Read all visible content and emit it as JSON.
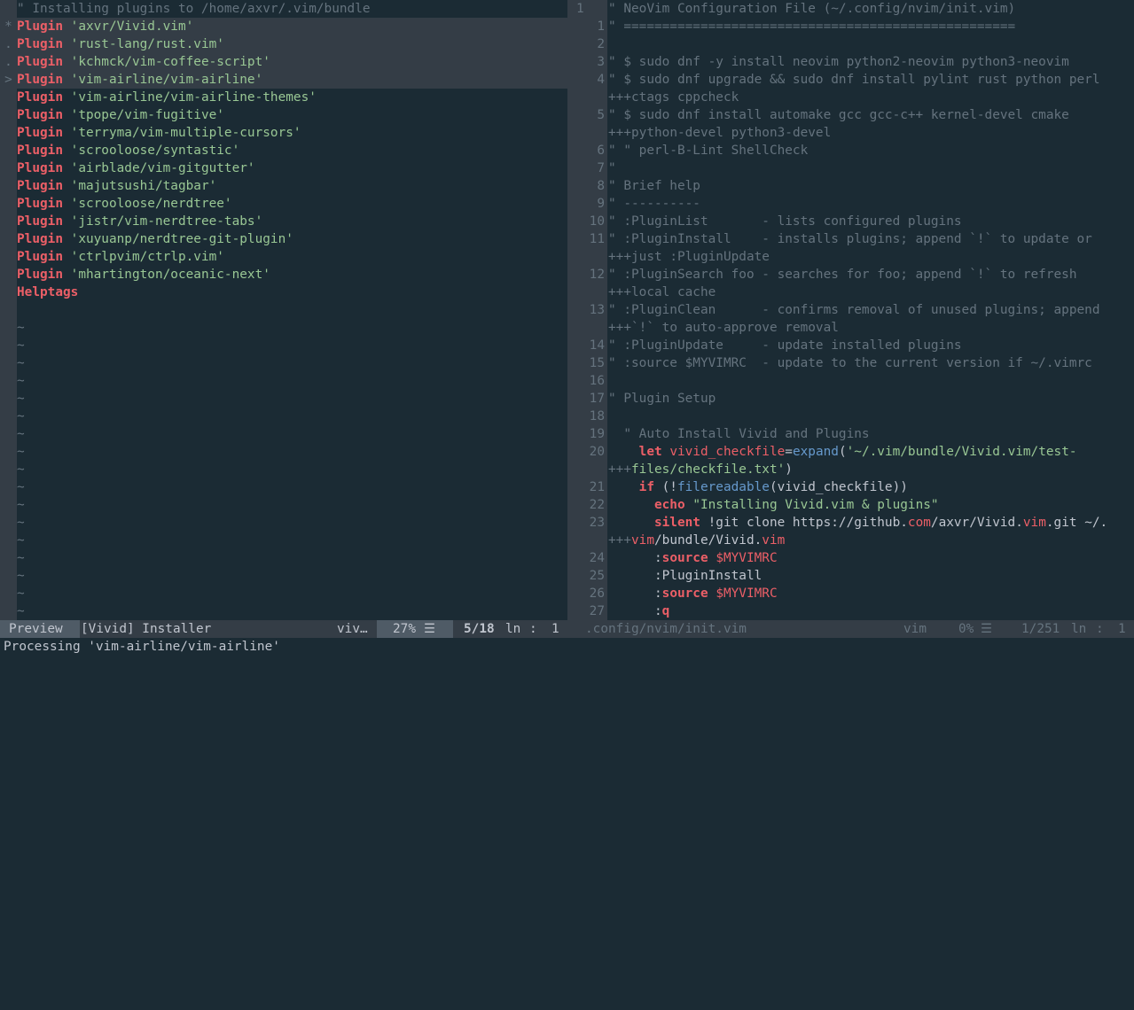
{
  "left": {
    "header": "\" Installing plugins to /home/axvr/.vim/bundle",
    "keyword": "Plugin",
    "plugins": [
      {
        "mark": "*",
        "name": "'axvr/Vivid.vim'",
        "highlight": true
      },
      {
        "mark": ".",
        "name": "'rust-lang/rust.vim'",
        "highlight": true
      },
      {
        "mark": ".",
        "name": "'kchmck/vim-coffee-script'",
        "highlight": true
      },
      {
        "mark": ">",
        "name": "'vim-airline/vim-airline'",
        "highlight": true
      },
      {
        "mark": "",
        "name": "'vim-airline/vim-airline-themes'",
        "highlight": false
      },
      {
        "mark": "",
        "name": "'tpope/vim-fugitive'",
        "highlight": false
      },
      {
        "mark": "",
        "name": "'terryma/vim-multiple-cursors'",
        "highlight": false
      },
      {
        "mark": "",
        "name": "'scrooloose/syntastic'",
        "highlight": false
      },
      {
        "mark": "",
        "name": "'airblade/vim-gitgutter'",
        "highlight": false
      },
      {
        "mark": "",
        "name": "'majutsushi/tagbar'",
        "highlight": false
      },
      {
        "mark": "",
        "name": "'scrooloose/nerdtree'",
        "highlight": false
      },
      {
        "mark": "",
        "name": "'jistr/vim-nerdtree-tabs'",
        "highlight": false
      },
      {
        "mark": "",
        "name": "'xuyuanp/nerdtree-git-plugin'",
        "highlight": false
      },
      {
        "mark": "",
        "name": "'ctrlpvim/ctrlp.vim'",
        "highlight": false
      },
      {
        "mark": "",
        "name": "'mhartington/oceanic-next'",
        "highlight": false
      }
    ],
    "helptags": "Helptags",
    "tilde_count": 17
  },
  "right": {
    "lines": [
      {
        "n": "1",
        "parts": [
          [
            "c",
            "\" NeoVim Configuration File (~/.config/nvim/init.vim)"
          ]
        ],
        "top_num": true
      },
      {
        "n": "1",
        "parts": [
          [
            "c",
            "\" ==================================================="
          ]
        ]
      },
      {
        "n": "2",
        "parts": []
      },
      {
        "n": "3",
        "parts": [
          [
            "c",
            "\" $ sudo dnf -y install neovim python2-neovim python3-neovim"
          ]
        ]
      },
      {
        "n": "4",
        "parts": [
          [
            "c",
            "\" $ sudo dnf upgrade && sudo dnf install pylint rust python perl"
          ]
        ]
      },
      {
        "n": "",
        "parts": [
          [
            "pl",
            "+++"
          ],
          [
            "c",
            "ctags cppcheck"
          ]
        ]
      },
      {
        "n": "5",
        "parts": [
          [
            "c",
            "\" $ sudo dnf install automake gcc gcc-c++ kernel-devel cmake"
          ]
        ]
      },
      {
        "n": "",
        "parts": [
          [
            "pl",
            "+++"
          ],
          [
            "c",
            "python-devel python3-devel"
          ]
        ]
      },
      {
        "n": "6",
        "parts": [
          [
            "c",
            "\" \" perl-B-Lint ShellCheck"
          ]
        ]
      },
      {
        "n": "7",
        "parts": [
          [
            "c",
            "\""
          ]
        ]
      },
      {
        "n": "8",
        "parts": [
          [
            "c",
            "\" Brief help"
          ]
        ]
      },
      {
        "n": "9",
        "parts": [
          [
            "c",
            "\" ----------"
          ]
        ]
      },
      {
        "n": "10",
        "parts": [
          [
            "c",
            "\" :PluginList       - lists configured plugins"
          ]
        ]
      },
      {
        "n": "11",
        "parts": [
          [
            "c",
            "\" :PluginInstall    - installs plugins; append `!` to update or"
          ]
        ]
      },
      {
        "n": "",
        "parts": [
          [
            "pl",
            "+++"
          ],
          [
            "c",
            "just :PluginUpdate"
          ]
        ]
      },
      {
        "n": "12",
        "parts": [
          [
            "c",
            "\" :PluginSearch foo - searches for foo; append `!` to refresh"
          ]
        ]
      },
      {
        "n": "",
        "parts": [
          [
            "pl",
            "+++"
          ],
          [
            "c",
            "local cache"
          ]
        ]
      },
      {
        "n": "13",
        "parts": [
          [
            "c",
            "\" :PluginClean      - confirms removal of unused plugins; append"
          ]
        ]
      },
      {
        "n": "",
        "parts": [
          [
            "pl",
            "+++"
          ],
          [
            "c",
            "`!` to auto-approve removal"
          ]
        ]
      },
      {
        "n": "14",
        "parts": [
          [
            "c",
            "\" :PluginUpdate     - update installed plugins"
          ]
        ]
      },
      {
        "n": "15",
        "parts": [
          [
            "c",
            "\" :source $MYVIMRC  - update to the current version if ~/.vimrc"
          ]
        ]
      },
      {
        "n": "16",
        "parts": []
      },
      {
        "n": "17",
        "parts": [
          [
            "c",
            "\" Plugin Setup"
          ]
        ]
      },
      {
        "n": "18",
        "parts": []
      },
      {
        "n": "19",
        "parts": [
          [
            "c",
            "  \" Auto Install Vivid and Plugins"
          ]
        ]
      },
      {
        "n": "20",
        "parts": [
          [
            "t",
            "    "
          ],
          [
            "kw2",
            "let"
          ],
          [
            "t",
            " "
          ],
          [
            "vr",
            "vivid_checkfile"
          ],
          [
            "t",
            "="
          ],
          [
            "fn",
            "expand"
          ],
          [
            "t",
            "("
          ],
          [
            "dq",
            "'~/.vim/bundle/Vivid.vim/test-"
          ]
        ]
      },
      {
        "n": "",
        "parts": [
          [
            "pl",
            "+++"
          ],
          [
            "dq",
            "files/checkfile.txt'"
          ],
          [
            "t",
            ")"
          ]
        ]
      },
      {
        "n": "21",
        "parts": [
          [
            "t",
            "    "
          ],
          [
            "kw2",
            "if"
          ],
          [
            "t",
            " (!"
          ],
          [
            "fn",
            "filereadable"
          ],
          [
            "t",
            "(vivid_checkfile))"
          ]
        ]
      },
      {
        "n": "22",
        "parts": [
          [
            "t",
            "      "
          ],
          [
            "kw2",
            "echo"
          ],
          [
            "t",
            " "
          ],
          [
            "dq",
            "\"Installing Vivid.vim & plugins\""
          ]
        ]
      },
      {
        "n": "23",
        "parts": [
          [
            "t",
            "      "
          ],
          [
            "kw2",
            "silent"
          ],
          [
            "t",
            " !git clone https://github."
          ],
          [
            "vr",
            "com"
          ],
          [
            "t",
            "/axvr/Vivid."
          ],
          [
            "vr",
            "vim"
          ],
          [
            "t",
            ".git ~/."
          ]
        ]
      },
      {
        "n": "",
        "parts": [
          [
            "pl",
            "+++"
          ],
          [
            "vr",
            "vim"
          ],
          [
            "t",
            "/bundle/Vivid."
          ],
          [
            "vr",
            "vim"
          ]
        ]
      },
      {
        "n": "24",
        "parts": [
          [
            "t",
            "      :"
          ],
          [
            "kw2",
            "source"
          ],
          [
            "t",
            " "
          ],
          [
            "vr",
            "$MYVIMRC"
          ]
        ]
      },
      {
        "n": "25",
        "parts": [
          [
            "t",
            "      :PluginInstall"
          ]
        ]
      },
      {
        "n": "26",
        "parts": [
          [
            "t",
            "      :"
          ],
          [
            "kw2",
            "source"
          ],
          [
            "t",
            " "
          ],
          [
            "vr",
            "$MYVIMRC"
          ]
        ]
      },
      {
        "n": "27",
        "parts": [
          [
            "t",
            "      :"
          ],
          [
            "kw2",
            "q"
          ]
        ]
      }
    ]
  },
  "status": {
    "mode": "Preview",
    "left_name": "[Vivid] Installer",
    "left_ft": "viv…",
    "left_pct": "27%",
    "left_icon": "☰",
    "left_pos": "5/18",
    "left_ln": "ln",
    "left_colon": ":",
    "left_col": "1",
    "right_file": ".config/nvim/init.vim",
    "right_ft": "vim",
    "right_pct": "0%",
    "right_icon": "☰",
    "right_pos": "1/251",
    "right_ln": "ln",
    "right_colon": ":",
    "right_col": "1"
  },
  "cmdline": "Processing 'vim-airline/vim-airline'"
}
